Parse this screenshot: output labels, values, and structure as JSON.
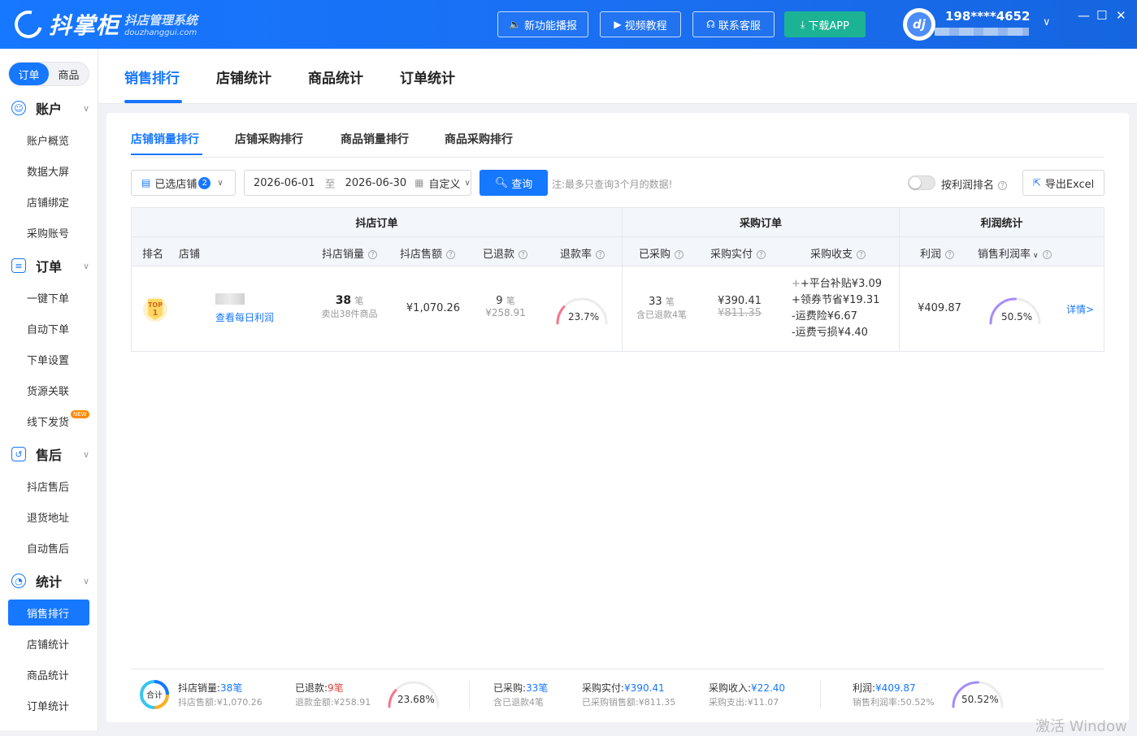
{
  "header": {
    "brand": "抖掌柜",
    "brand_sub": "抖店管理系统",
    "brand_domain": "douzhanggui.com",
    "buttons": [
      {
        "label": "新功能播报",
        "icon": "speaker-icon"
      },
      {
        "label": "视频教程",
        "icon": "video-icon"
      },
      {
        "label": "联系客服",
        "icon": "headset-icon"
      },
      {
        "label": "下载APP",
        "icon": "download-icon"
      }
    ],
    "user_phone": "198****4652"
  },
  "sidebar": {
    "segment": [
      "订单",
      "商品"
    ],
    "groups": [
      {
        "title": "账户",
        "items": [
          "账户概览",
          "数据大屏",
          "店铺绑定",
          "采购账号"
        ]
      },
      {
        "title": "订单",
        "items": [
          "一键下单",
          "自动下单",
          "下单设置",
          "货源关联",
          "线下发货"
        ]
      },
      {
        "title": "售后",
        "items": [
          "抖店售后",
          "退货地址",
          "自动售后"
        ]
      },
      {
        "title": "统计",
        "items": [
          "销售排行",
          "店铺统计",
          "商品统计",
          "订单统计"
        ]
      }
    ],
    "new_badge": "NEW"
  },
  "top_tabs": [
    "销售排行",
    "店铺统计",
    "商品统计",
    "订单统计"
  ],
  "sub_tabs": [
    "店铺销量排行",
    "店铺采购排行",
    "商品销量排行",
    "商品采购排行"
  ],
  "filters": {
    "store_select": "已选店铺",
    "store_count": "2",
    "date_start": "2026-06-01",
    "date_sep": "至",
    "date_end": "2026-06-30",
    "range_mode": "自定义",
    "query_label": "查询",
    "note": "注:最多只查询3个月的数据!",
    "toggle_label": "按利润排名",
    "export_label": "导出Excel"
  },
  "table": {
    "groups": [
      "抖店订单",
      "采购订单",
      "利润统计"
    ],
    "columns": [
      "排名",
      "店铺",
      "抖店销量",
      "抖店售额",
      "已退款",
      "退款率",
      "已采购",
      "采购实付",
      "采购收支",
      "利润",
      "销售利润率"
    ],
    "rows": [
      {
        "rank_top": "TOP",
        "rank": "1",
        "store_link": "查看每日利润",
        "sales_qty": "38",
        "unit": "笔",
        "sales_sub": "卖出38件商品",
        "sales_amount": "¥1,070.26",
        "refund_qty": "9",
        "refund_amount": "¥258.91",
        "refund_rate": "23.7%",
        "refund_rate_value": 23.7,
        "purchased_qty": "33",
        "purchased_sub": "含已退款4笔",
        "purchase_paid": "¥390.41",
        "purchase_paid_orig": "¥811.35",
        "balance": [
          "+平台补贴¥3.09",
          "+领券节省¥19.31",
          "-运费险¥6.67",
          "-运费亏损¥4.40"
        ],
        "profit": "¥409.87",
        "profit_rate": "50.5%",
        "profit_rate_value": 50.5,
        "detail": "详情>"
      }
    ]
  },
  "summary": {
    "badge": "合计",
    "sales_qty_label": "抖店销量:",
    "sales_qty": "38笔",
    "sales_amount_label": "抖店售额:",
    "sales_amount": "¥1,070.26",
    "refund_label": "已退款:",
    "refund": "9笔",
    "refund_amount_label": "退款金额:",
    "refund_amount": "¥258.91",
    "refund_rate": "23.68%",
    "refund_rate_value": 23.68,
    "purchased_label": "已采购:",
    "purchased": "33笔",
    "purchased_sub": "含已退款4笔",
    "paid_label": "采购实付:",
    "paid": "¥390.41",
    "paid_sales_label": "已采购销售额:",
    "paid_sales": "¥811.35",
    "income_label": "采购收入:",
    "income": "¥22.40",
    "expense_label": "采购支出:",
    "expense": "¥11.07",
    "profit_label": "利润:",
    "profit": "¥409.87",
    "profit_rate_label": "销售利润率:",
    "profit_rate_text": "50.52%",
    "profit_rate": "50.52%",
    "profit_rate_value": 50.52
  },
  "watermark": "激活 Window",
  "colors": {
    "primary": "#1677ff",
    "green": "#1bb394",
    "refund_red": "#e0453a"
  }
}
